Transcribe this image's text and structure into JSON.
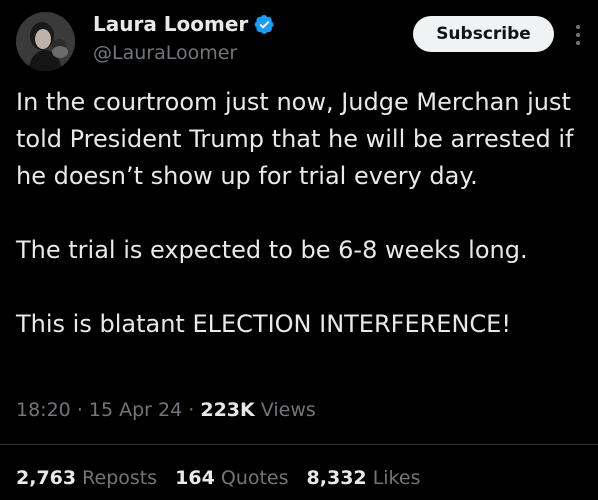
{
  "author": {
    "display_name": "Laura Loomer",
    "handle": "@LauraLoomer",
    "verified_color": "#1d9bf0"
  },
  "actions": {
    "subscribe_label": "Subscribe",
    "more_icon": "more-vertical-icon"
  },
  "tweet": {
    "paragraphs": [
      "In the courtroom just now, Judge Merchan just told President Trump that he will be arrested if he doesn’t show up for trial every day.",
      "The trial is expected to be 6-8 weeks long.",
      "This is blatant ELECTION INTERFERENCE!"
    ]
  },
  "meta": {
    "time": "18:20",
    "date": "15 Apr 24",
    "separator": "·",
    "views_count": "223K",
    "views_label": "Views"
  },
  "stats": {
    "reposts_count": "2,763",
    "reposts_label": "Reposts",
    "quotes_count": "164",
    "quotes_label": "Quotes",
    "likes_count": "8,332",
    "likes_label": "Likes"
  },
  "colors": {
    "background": "#000000",
    "text": "#e7e9ea",
    "secondary": "#71767b",
    "divider": "#2f3336"
  }
}
